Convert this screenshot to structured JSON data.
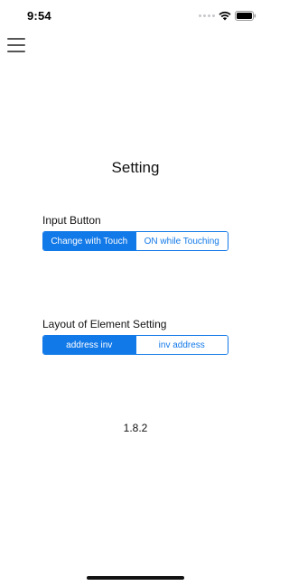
{
  "status_bar": {
    "time": "9:54",
    "icons": [
      "signal-dots-icon",
      "wifi-icon",
      "battery-icon"
    ]
  },
  "menu": {
    "icon": "hamburger-menu-icon"
  },
  "page": {
    "title": "Setting",
    "version": "1.8.2"
  },
  "input_button": {
    "label": "Input Button",
    "options": [
      "Change with Touch",
      "ON while Touching"
    ],
    "selected": "Change with Touch"
  },
  "layout_setting": {
    "label": "Layout of Element Setting",
    "options": [
      "address inv",
      "inv address"
    ],
    "selected": "address inv"
  },
  "colors": {
    "accent": "#1279e8",
    "background": "#ffffff",
    "text": "#111111"
  }
}
